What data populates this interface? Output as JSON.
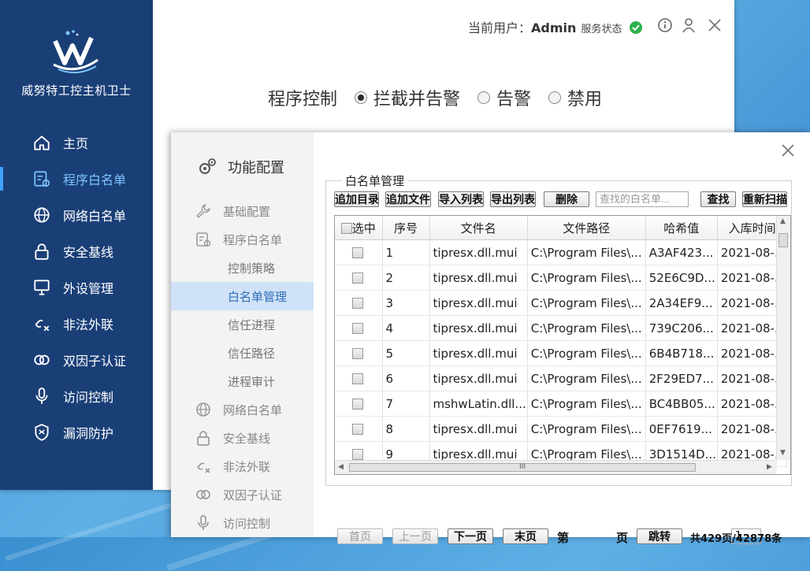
{
  "app": {
    "title": "威努特工控主机卫士",
    "nav": [
      {
        "label": "主页",
        "icon": "home-icon",
        "active": false
      },
      {
        "label": "程序白名单",
        "icon": "app-list-icon",
        "active": true
      },
      {
        "label": "网络白名单",
        "icon": "globe-icon",
        "active": false
      },
      {
        "label": "安全基线",
        "icon": "lock-icon",
        "active": false
      },
      {
        "label": "外设管理",
        "icon": "monitor-icon",
        "active": false
      },
      {
        "label": "非法外联",
        "icon": "broken-link-icon",
        "active": false
      },
      {
        "label": "双因子认证",
        "icon": "double-ring-icon",
        "active": false
      },
      {
        "label": "访问控制",
        "icon": "microphone-icon",
        "active": false
      },
      {
        "label": "漏洞防护",
        "icon": "shield-icon",
        "active": false
      }
    ]
  },
  "topbar": {
    "user_prefix": "当前用户：",
    "user_name": "Admin",
    "service_status": "服务状态"
  },
  "program_control": {
    "label": "程序控制",
    "options": [
      {
        "label": "拦截并告警",
        "selected": true
      },
      {
        "label": "告警",
        "selected": false
      },
      {
        "label": "禁用",
        "selected": false
      }
    ]
  },
  "dialog": {
    "title": "功能配置",
    "side": [
      {
        "label": "基础配置",
        "icon": "wrench-icon",
        "type": "top"
      },
      {
        "label": "程序白名单",
        "icon": "app-list-icon",
        "type": "top"
      },
      {
        "label": "控制策略",
        "type": "sub"
      },
      {
        "label": "白名单管理",
        "type": "sub",
        "active": true
      },
      {
        "label": "信任进程",
        "type": "sub"
      },
      {
        "label": "信任路径",
        "type": "sub"
      },
      {
        "label": "进程审计",
        "type": "sub"
      },
      {
        "label": "网络白名单",
        "icon": "globe-icon",
        "type": "top"
      },
      {
        "label": "安全基线",
        "icon": "lock-icon",
        "type": "top"
      },
      {
        "label": "非法外联",
        "icon": "broken-link-icon",
        "type": "top"
      },
      {
        "label": "双因子认证",
        "icon": "double-ring-icon",
        "type": "top"
      },
      {
        "label": "访问控制",
        "icon": "microphone-icon",
        "type": "top"
      }
    ],
    "group_title": "白名单管理",
    "toolbar": {
      "add_dir": "追加目录",
      "add_file": "追加文件",
      "import": "导入列表",
      "export": "导出列表",
      "delete": "删除",
      "search_placeholder": "查找的白名单...",
      "search": "查找",
      "rescan": "重新扫描"
    },
    "columns": [
      "选中",
      "序号",
      "文件名",
      "文件路径",
      "哈希值",
      "入库时间"
    ],
    "rows": [
      {
        "no": "1",
        "file": "tipresx.dll.mui",
        "path": "C:\\Program Files\\...",
        "hash": "A3AF423...",
        "time": "2021-08-..."
      },
      {
        "no": "2",
        "file": "tipresx.dll.mui",
        "path": "C:\\Program Files\\...",
        "hash": "52E6C9D...",
        "time": "2021-08-..."
      },
      {
        "no": "3",
        "file": "tipresx.dll.mui",
        "path": "C:\\Program Files\\...",
        "hash": "2A34EF9...",
        "time": "2021-08-..."
      },
      {
        "no": "4",
        "file": "tipresx.dll.mui",
        "path": "C:\\Program Files\\...",
        "hash": "739C206...",
        "time": "2021-08-..."
      },
      {
        "no": "5",
        "file": "tipresx.dll.mui",
        "path": "C:\\Program Files\\...",
        "hash": "6B4B718...",
        "time": "2021-08-..."
      },
      {
        "no": "6",
        "file": "tipresx.dll.mui",
        "path": "C:\\Program Files\\...",
        "hash": "2F29ED7...",
        "time": "2021-08-..."
      },
      {
        "no": "7",
        "file": "mshwLatin.dll...",
        "path": "C:\\Program Files\\...",
        "hash": "BC4BB05...",
        "time": "2021-08-..."
      },
      {
        "no": "8",
        "file": "tipresx.dll.mui",
        "path": "C:\\Program Files\\...",
        "hash": "0EF7619...",
        "time": "2021-08-..."
      },
      {
        "no": "9",
        "file": "tipresx.dll.mui",
        "path": "C:\\Program Files\\...",
        "hash": "3D1514D...",
        "time": "2021-08-..."
      }
    ],
    "pager": {
      "first": "首页",
      "prev": "上一页",
      "next": "下一页",
      "last": "末页",
      "page_label": "第",
      "page_value": "1",
      "page_unit": "页",
      "jump": "跳转",
      "summary": "共429页/42878条"
    }
  },
  "colors": {
    "nav_bg": "#1a3f77",
    "nav_active": "#7ec4ff",
    "status_ok": "#2bb24c",
    "side_active_bg": "#cfe2f7"
  }
}
